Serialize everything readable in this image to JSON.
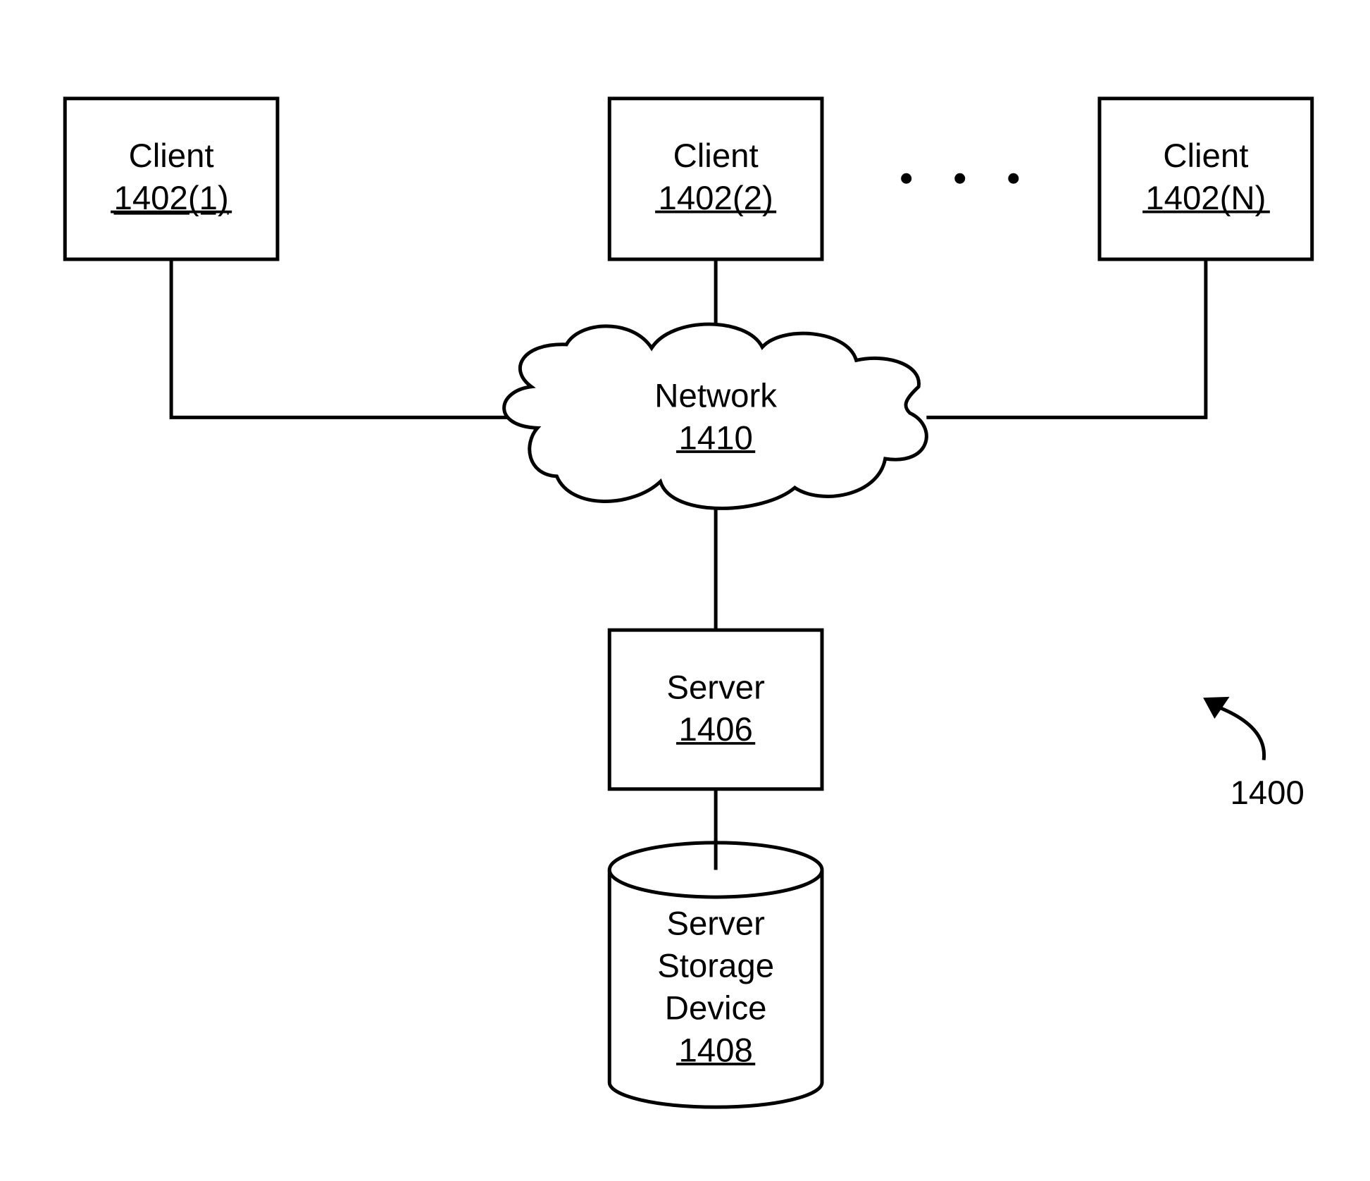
{
  "figure": {
    "reference_numeral": "1400",
    "nodes": {
      "client1": {
        "label": "Client",
        "ref": "1402(1)"
      },
      "client2": {
        "label": "Client",
        "ref": "1402(2)"
      },
      "clientN": {
        "label": "Client",
        "ref": "1402(N)"
      },
      "ellipsis": "•   •   •",
      "network": {
        "label": "Network",
        "ref": "1410"
      },
      "server": {
        "label": "Server",
        "ref": "1406"
      },
      "storage": {
        "label_lines": [
          "Server",
          "Storage",
          "Device"
        ],
        "ref": "1408"
      }
    },
    "connections": [
      [
        "client1",
        "network"
      ],
      [
        "client2",
        "network"
      ],
      [
        "clientN",
        "network"
      ],
      [
        "network",
        "server"
      ],
      [
        "server",
        "storage"
      ]
    ]
  }
}
